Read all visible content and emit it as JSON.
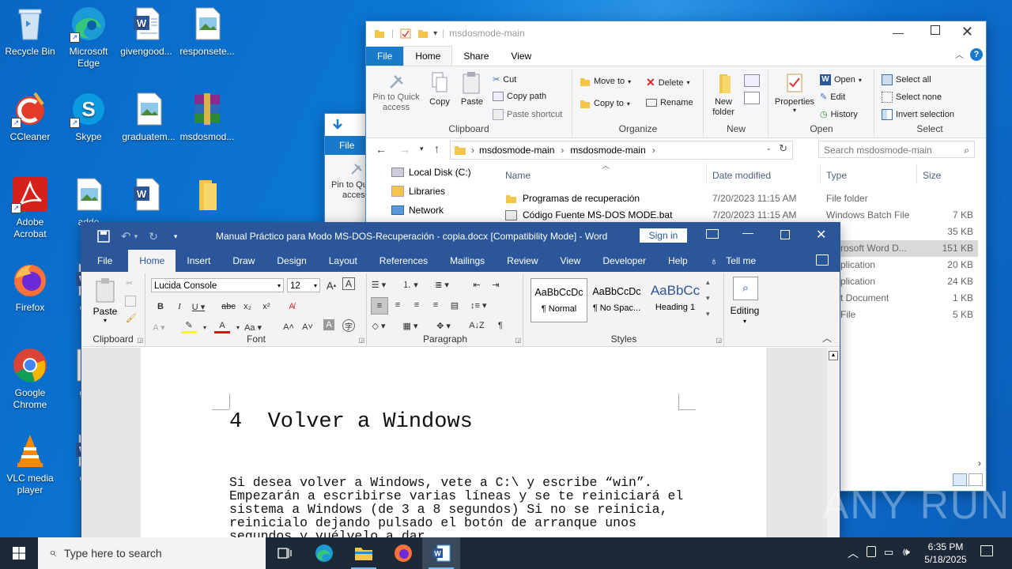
{
  "desktop": {
    "icons": [
      {
        "label": "Recycle Bin"
      },
      {
        "label": "Microsoft Edge"
      },
      {
        "label": "givengood..."
      },
      {
        "label": "responsete..."
      },
      {
        "label": "CCleaner"
      },
      {
        "label": "Skype"
      },
      {
        "label": "graduatem..."
      },
      {
        "label": "msdosmod..."
      },
      {
        "label": "Adobe Acrobat"
      },
      {
        "label": "adde"
      },
      {
        "label": ""
      },
      {
        "label": ""
      },
      {
        "label": "Firefox"
      },
      {
        "label": "cent"
      },
      {
        "label": "Google Chrome"
      },
      {
        "label": "gam"
      },
      {
        "label": "VLC media player"
      },
      {
        "label": "getti"
      }
    ]
  },
  "explorer_back": {
    "tab_file": "File",
    "pin_label": "Pin to Qu",
    "access_label": "acces"
  },
  "explorer": {
    "title": "msdosmode-main",
    "tabs": {
      "file": "File",
      "home": "Home",
      "share": "Share",
      "view": "View"
    },
    "clipboard": {
      "pin": "Pin to Quick access",
      "copy": "Copy",
      "paste": "Paste",
      "cut": "Cut",
      "copy_path": "Copy path",
      "paste_shortcut": "Paste shortcut",
      "group": "Clipboard"
    },
    "organize": {
      "move_to": "Move to",
      "copy_to": "Copy to",
      "delete": "Delete",
      "rename": "Rename",
      "group": "Organize"
    },
    "new": {
      "new_folder": "New folder",
      "group": "New"
    },
    "open": {
      "properties": "Properties",
      "open": "Open",
      "edit": "Edit",
      "history": "History",
      "group": "Open"
    },
    "select": {
      "select_all": "Select all",
      "select_none": "Select none",
      "invert": "Invert selection",
      "group": "Select"
    },
    "breadcrumb": [
      "msdosmode-main",
      "msdosmode-main"
    ],
    "search_placeholder": "Search msdosmode-main",
    "nav": [
      {
        "label": "Local Disk (C:)"
      },
      {
        "label": "Libraries"
      },
      {
        "label": "Network"
      }
    ],
    "columns": {
      "name": "Name",
      "date": "Date modified",
      "type": "Type",
      "size": "Size"
    },
    "files": [
      {
        "name": "Programas de recuperación",
        "date": "7/20/2023 11:15 AM",
        "type": "File folder",
        "size": ""
      },
      {
        "name": "Código Fuente MS-DOS MODE.bat",
        "date": "7/20/2023 11:15 AM",
        "type": "Windows Batch File",
        "size": "7 KB"
      },
      {
        "name": "",
        "date": "",
        "type": "",
        "size": "35 KB"
      },
      {
        "name": "",
        "date": "",
        "type": "rosoft Word D...",
        "size": "151 KB"
      },
      {
        "name": "",
        "date": "",
        "type": "plication",
        "size": "20 KB"
      },
      {
        "name": "",
        "date": "",
        "type": "plication",
        "size": "24 KB"
      },
      {
        "name": "",
        "date": "",
        "type": "t Document",
        "size": "1 KB"
      },
      {
        "name": "",
        "date": "",
        "type": "File",
        "size": "5 KB"
      }
    ]
  },
  "word": {
    "title": "Manual Práctico para Modo MS-DOS-Recuperación - copia.docx [Compatibility Mode]  -  Word",
    "sign_in": "Sign in",
    "tabs": [
      "File",
      "Home",
      "Insert",
      "Draw",
      "Design",
      "Layout",
      "References",
      "Mailings",
      "Review",
      "View",
      "Developer",
      "Help"
    ],
    "tell_me": "Tell me",
    "clipboard": {
      "paste": "Paste",
      "group": "Clipboard"
    },
    "font": {
      "name": "Lucida Console",
      "size": "12",
      "group": "Font"
    },
    "paragraph": {
      "group": "Paragraph"
    },
    "styles": {
      "items": [
        {
          "preview": "AaBbCcDc",
          "name": "¶ Normal"
        },
        {
          "preview": "AaBbCcDc",
          "name": "¶ No Spac..."
        },
        {
          "preview": "AaBbCc",
          "name": "Heading 1"
        }
      ],
      "group": "Styles"
    },
    "editing": {
      "label": "Editing"
    },
    "doc": {
      "heading_num": "4",
      "heading_text": "Volver a Windows",
      "para": "Si desea volver a Windows, vete a C:\\ y escribe “win”.\nEmpezarán a escribirse varias líneas y se te reiniciará el\nsistema a Windows (de 3 a 8 segundos) Si no se reinicia,\nreinicialo dejando pulsado el botón de arranque unos\nsegundos y vuélvelo a dar."
    }
  },
  "taskbar": {
    "search_placeholder": "Type here to search",
    "time": "6:35 PM",
    "date": "5/18/2025"
  },
  "watermark": "ANY RUN",
  "colors": {
    "word_blue": "#2b579a",
    "explorer_file_tab": "#1979ca",
    "taskbar": "#1c2a38"
  }
}
